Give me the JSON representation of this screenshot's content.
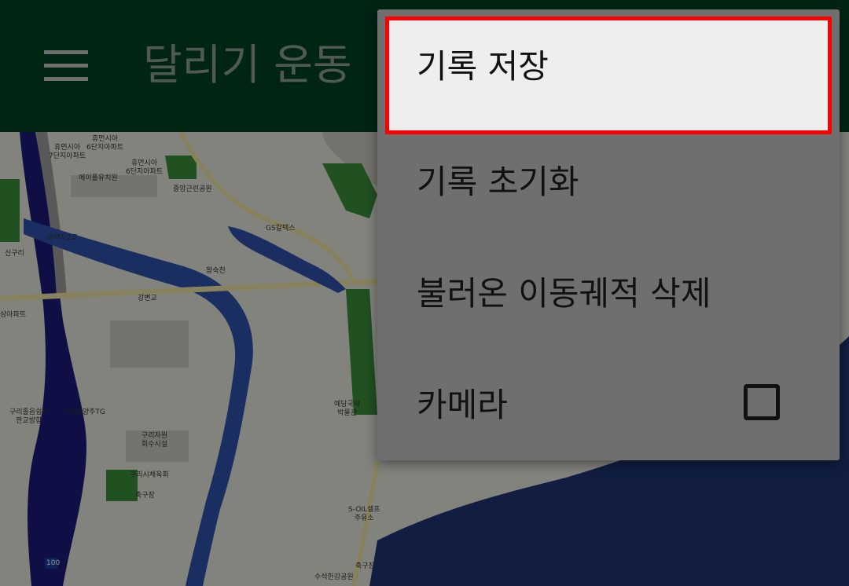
{
  "toolbar": {
    "title": "달리기 운동",
    "menu_icon": "hamburger-menu-icon",
    "background_color": "#00401f"
  },
  "overflow_menu": {
    "items": [
      {
        "label": "기록 저장",
        "highlighted": true
      },
      {
        "label": "기록 초기화"
      },
      {
        "label": "불러온 이동궤적 삭제"
      },
      {
        "label": "카메라",
        "checkbox": true,
        "checked": false
      }
    ],
    "highlight_color": "#ff0000"
  },
  "map": {
    "labels": {
      "apt1": "휴먼시아\n6단지아파트",
      "apt2": "휴먼시아\n7단지아파트",
      "apt3": "휴먼시아\n6단지아파트",
      "kindergarten": "메이플유치원",
      "park": "중앙근린공원",
      "gas": "GS칼텍스",
      "road1": "수택지2교",
      "bridge": "강변교",
      "river_stream": "왕숙천",
      "station_sign": "신구리",
      "apt_left": "삼아파트",
      "gym": "구리시체육회",
      "sports": "축구장",
      "center": "구리자원\n회수시설",
      "museum": "예당국악\n박물관",
      "ic": "구리남양주TG",
      "jct": "구리졸음쉼터\n판교방향",
      "station2": "S-OIL셀프\n주유소",
      "sports2": "축구장",
      "bottom": "수석한강공원",
      "highway_num": "100"
    }
  }
}
